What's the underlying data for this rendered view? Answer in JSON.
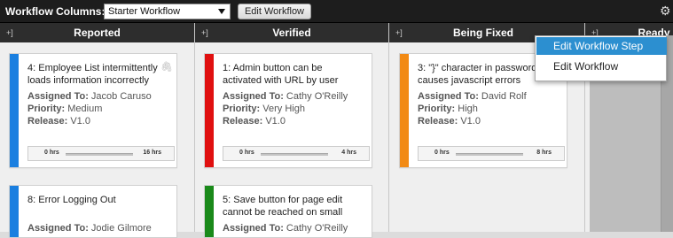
{
  "toolbar": {
    "label": "Workflow Columns:",
    "select_value": "Starter Workflow",
    "edit_button": "Edit Workflow"
  },
  "icons": {
    "gear": "gear-icon",
    "collapse": "collapse-icon",
    "paperclip": "paperclip-icon"
  },
  "collapse_glyph": "+]",
  "columns": [
    {
      "title": "Reported"
    },
    {
      "title": "Verified"
    },
    {
      "title": "Being Fixed"
    },
    {
      "title": "Ready"
    }
  ],
  "labels": {
    "assigned": "Assigned To:",
    "priority": "Priority:",
    "release": "Release:"
  },
  "cards": [
    {
      "title": "4: Employee List intermittently loads information incorrectly",
      "assigned": "Jacob Caruso",
      "priority": "Medium",
      "release": "V1.0",
      "hrs_start": "0 hrs",
      "hrs_end": "16 hrs",
      "color": "#1a7fe0"
    },
    {
      "title": "1: Admin button can be activated with URL by user",
      "assigned": "Cathy O'Reilly",
      "priority": "Very High",
      "release": "V1.0",
      "hrs_start": "0 hrs",
      "hrs_end": "4 hrs",
      "color": "#e01010"
    },
    {
      "title": "3: \"}\" character in password causes javascript errors",
      "assigned": "David Rolf",
      "priority": "High",
      "release": "V1.0",
      "hrs_start": "0 hrs",
      "hrs_end": "8 hrs",
      "color": "#f28a14"
    },
    {
      "title": "8: Error Logging Out",
      "assigned": "Jodie Gilmore",
      "color": "#1a7fe0"
    },
    {
      "title": "5: Save button for page edit cannot be reached on small",
      "assigned": "Cathy O'Reilly",
      "color": "#1a8a1a"
    }
  ],
  "menu": {
    "items": [
      "Edit Workflow Step",
      "Edit Workflow"
    ]
  }
}
